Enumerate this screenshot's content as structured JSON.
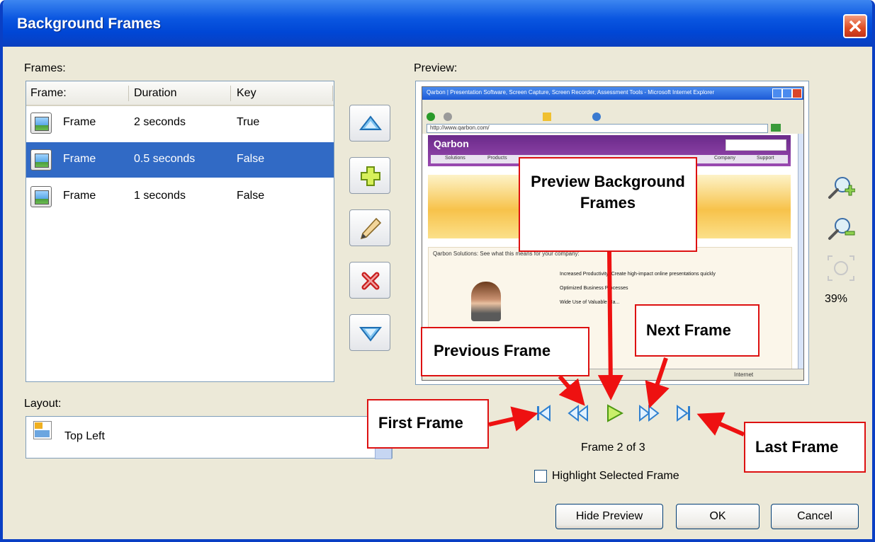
{
  "window": {
    "title": "Background Frames"
  },
  "frames": {
    "label": "Frames:",
    "columns": [
      "Frame:",
      "Duration",
      "Key"
    ],
    "rows": [
      {
        "name": "Frame",
        "duration": "2 seconds",
        "key": "True",
        "selected": false
      },
      {
        "name": "Frame",
        "duration": "0.5 seconds",
        "key": "False",
        "selected": true
      },
      {
        "name": "Frame",
        "duration": "1 seconds",
        "key": "False",
        "selected": false
      }
    ]
  },
  "side_buttons": [
    "move-up-icon",
    "add-icon",
    "edit-pencil-icon",
    "delete-icon",
    "move-down-icon"
  ],
  "preview": {
    "label": "Preview:",
    "zoom": "39%",
    "frame_counter": "Frame 2 of 3",
    "highlight_label": "Highlight Selected Frame",
    "browser_title": "Qarbon | Presentation Software, Screen Capture, Screen Recorder, Assessment Tools - Microsoft Internet Explorer",
    "address": "http://www.qarbon.com/",
    "site_logo": "Qarbon",
    "menu": [
      "Solutions",
      "Products",
      "Company",
      "Support"
    ],
    "promo_text": "Qarbon Solutions: See what this means for your company:",
    "bullets": [
      "Increased Productivity: Create high-impact online presentations quickly",
      "Optimized Business Processes",
      "Wide Use of Valuable Ma..."
    ],
    "status": "Internet"
  },
  "layout": {
    "label": "Layout:",
    "value": "Top Left"
  },
  "callouts": {
    "preview": "Preview Background Frames",
    "previous": "Previous Frame",
    "next": "Next Frame",
    "first": "First Frame",
    "last": "Last Frame"
  },
  "buttons": {
    "hide_preview": "Hide Preview",
    "ok": "OK",
    "cancel": "Cancel"
  },
  "colors": {
    "selection": "#316ac5",
    "title_bar": "#0a56e0",
    "callout_border": "#dd1111",
    "arrow": "#ee1111"
  }
}
